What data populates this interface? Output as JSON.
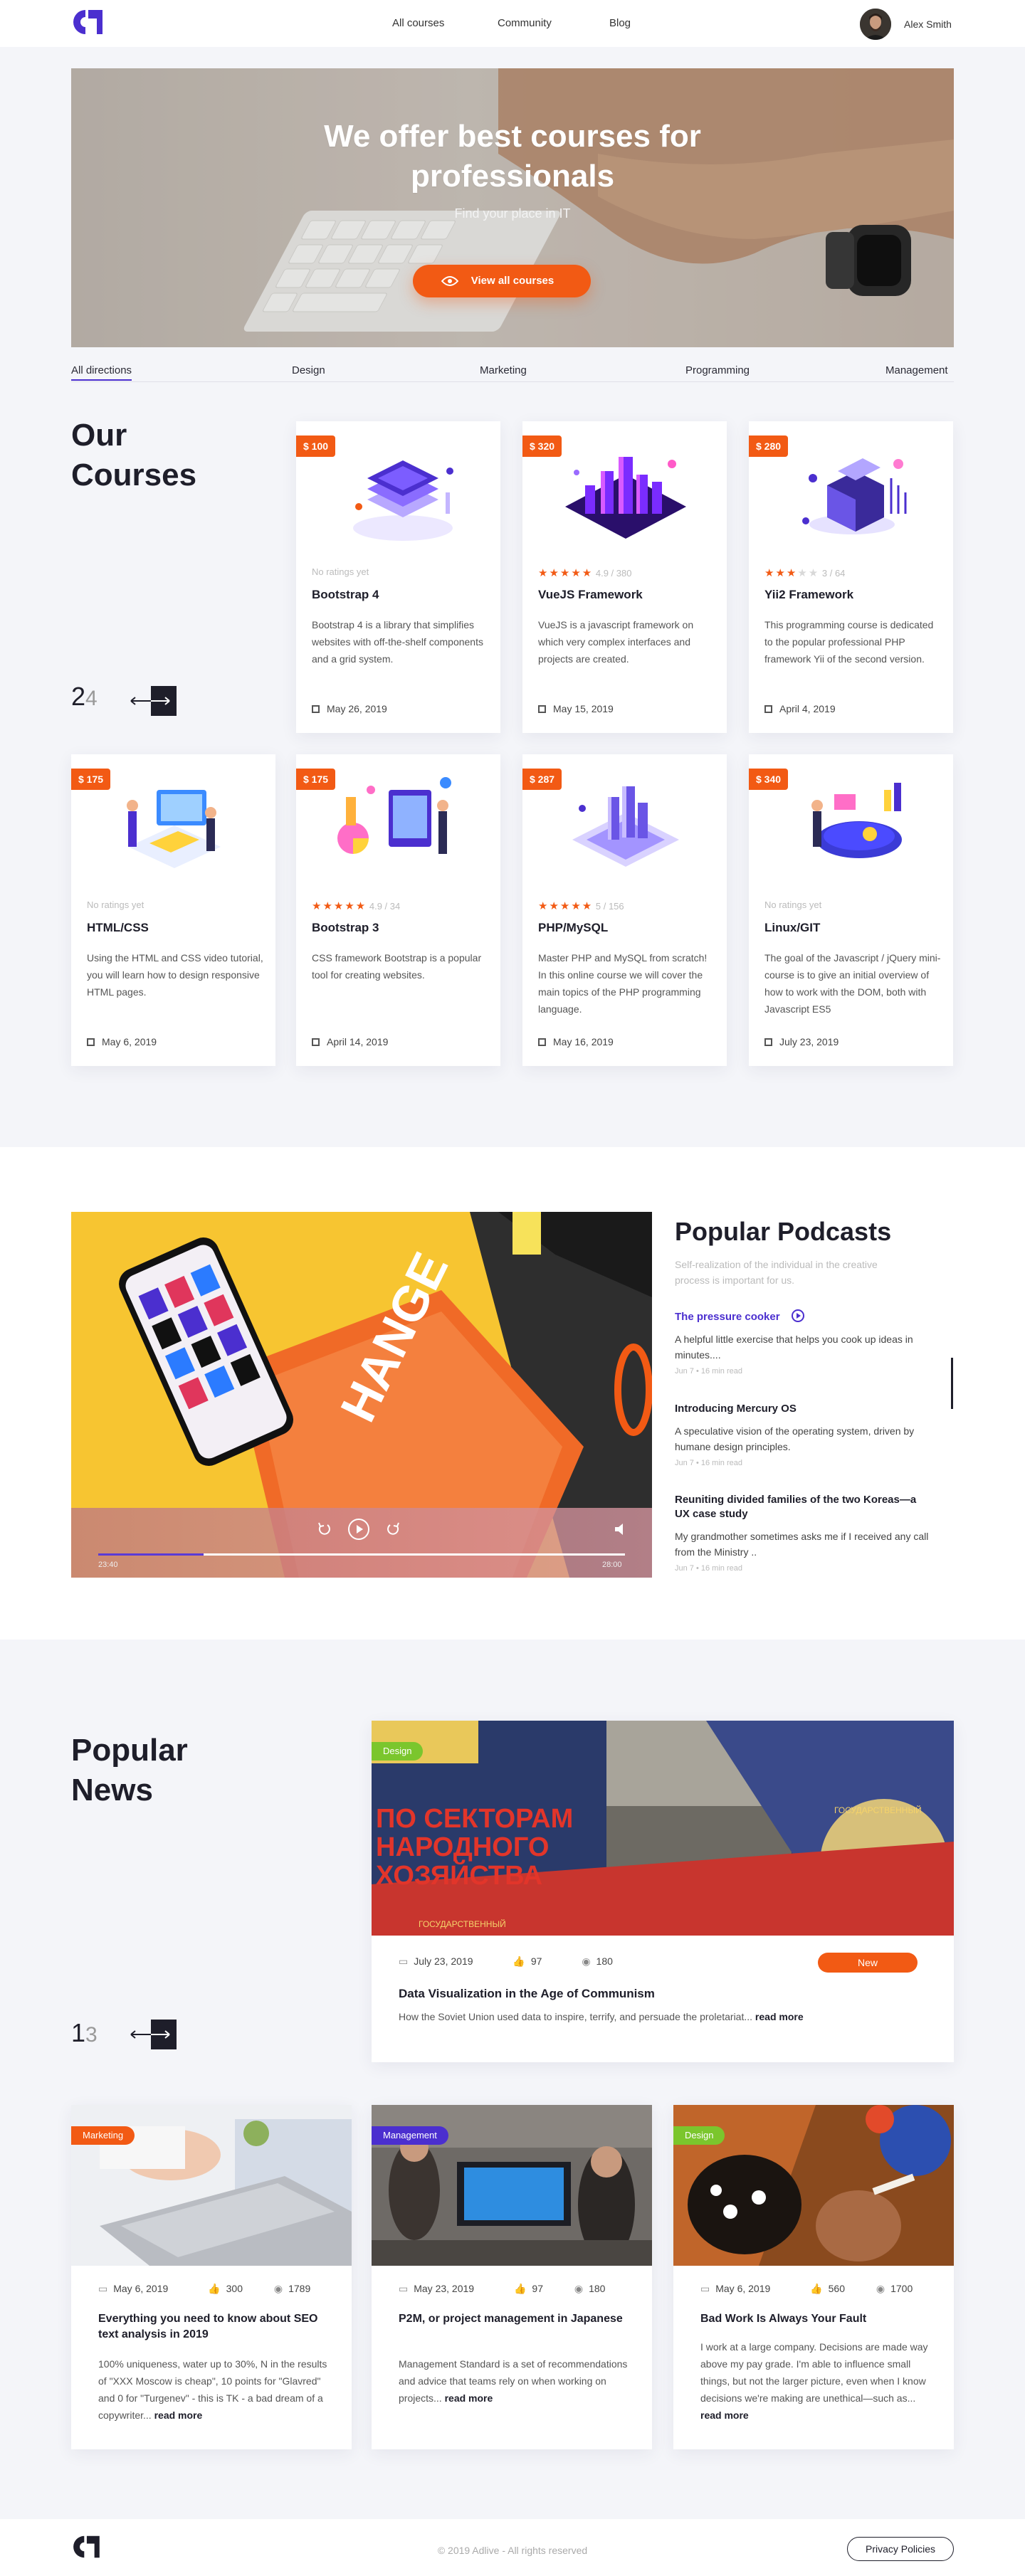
{
  "header": {
    "nav": [
      "All courses",
      "Community",
      "Blog"
    ],
    "user_name": "Alex Smith"
  },
  "hero": {
    "title_line1": "We offer best courses for",
    "title_line2": "professionals",
    "subtitle": "Find your place in IT",
    "button_label": "View all courses"
  },
  "tabs": [
    "All directions",
    "Design",
    "Marketing",
    "Programming",
    "Management"
  ],
  "courses": {
    "title_line1": "Our",
    "title_line2": "Courses",
    "page_current": "2",
    "page_total": "4",
    "items": [
      {
        "price": "$ 100",
        "rating_text": "No ratings yet",
        "title": "Bootstrap 4",
        "desc": "Bootstrap 4 is a library that simplifies websites with off-the-shelf components and a grid system.",
        "date": "May 26, 2019",
        "stars": 0,
        "score": ""
      },
      {
        "price": "$ 320",
        "rating_text": "4.9 / 380",
        "title": "VueJS Framework",
        "desc": "VueJS is a javascript framework on which very complex interfaces and projects are created.",
        "date": "May 15, 2019",
        "stars": 5,
        "score": "4.9 / 380"
      },
      {
        "price": "$ 280",
        "rating_text": "3 / 64",
        "title": "Yii2 Framework",
        "desc": "This programming course is dedicated to the popular professional PHP framework Yii of the second version.",
        "date": "April 4, 2019",
        "stars": 3,
        "score": "3 / 64"
      },
      {
        "price": "$ 175",
        "rating_text": "No ratings yet",
        "title": "HTML/CSS",
        "desc": "Using the HTML and CSS video tutorial, you will learn how to design responsive HTML pages.",
        "date": "May 6, 2019",
        "stars": 0,
        "score": ""
      },
      {
        "price": "$ 175",
        "rating_text": "4.9 / 34",
        "title": "Bootstrap 3",
        "desc": "CSS framework Bootstrap is a popular tool for creating websites.",
        "date": "April 14, 2019",
        "stars": 5,
        "score": "4.9 / 34"
      },
      {
        "price": "$ 287",
        "rating_text": "5 / 156",
        "title": "PHP/MySQL",
        "desc": "Master PHP and MySQL from scratch! In this online course we will cover the main topics of the PHP programming language.",
        "date": "May 16, 2019",
        "stars": 5,
        "score": "5 / 156"
      },
      {
        "price": "$ 340",
        "rating_text": "No ratings yet",
        "title": "Linux/GIT",
        "desc": "The goal of the Javascript / jQuery mini-course is to give an initial overview of how to work with the DOM, both with Javascript ES5",
        "date": "July 23, 2019",
        "stars": 0,
        "score": ""
      }
    ]
  },
  "podcasts": {
    "title": "Popular Podcasts",
    "subtitle": "Self-realization of the individual in the creative process is important for us.",
    "player": {
      "elapsed": "23:40",
      "total": "28:00",
      "progress": 0.2
    },
    "items": [
      {
        "title": "The pressure cooker",
        "desc": "A helpful little exercise that helps you cook up ideas in minutes....",
        "meta": "Jun 7  •  16 min read"
      },
      {
        "title": "Introducing Mercury OS",
        "desc": "A speculative vision of the operating system, driven by humane design principles.",
        "meta": "Jun 7  •  16 min read"
      },
      {
        "title": "Reuniting divided families of the two Koreas—a UX case study",
        "desc": "My grandmother sometimes asks me if I received any call from the Ministry ..",
        "meta": "Jun 7  •  16 min read"
      }
    ]
  },
  "news": {
    "title_line1": "Popular",
    "title_line2": "News",
    "page_current": "1",
    "page_total": "3",
    "featured": {
      "badge": "Design",
      "date": "July 23, 2019",
      "likes": "97",
      "views": "180",
      "new_label": "New",
      "title": "Data Visualization in the Age of Communism",
      "desc": "How the Soviet Union used data to inspire, terrify, and persuade the proletariat...",
      "read_more": "read more",
      "poster_text_1": "ПО СЕКТОРАМ",
      "poster_text_2": "НАРОДНОГО",
      "poster_text_3": "ХОЗЯЙСТВА",
      "poster_small": "ГОСУДАРСТВЕННЫЙ"
    },
    "items": [
      {
        "badge": "Marketing",
        "date": "May 6, 2019",
        "likes": "300",
        "views": "1789",
        "title": "Everything you need to know about SEO text analysis in 2019",
        "desc": "100% uniqueness, water up to 30%, N in the results of \"XXX Moscow is cheap\", 10 points for \"Glavred\" and 0 for \"Turgenev\" - this is TK - a bad dream of a copywriter...",
        "read_more": "read more"
      },
      {
        "badge": "Management",
        "date": "May 23, 2019",
        "likes": "97",
        "views": "180",
        "title": "P2M, or project management in Japanese",
        "desc": "Management Standard is a set of recommendations and advice that teams rely on when working on projects...",
        "read_more": "read more"
      },
      {
        "badge": "Design",
        "date": "May 6, 2019",
        "likes": "560",
        "views": "1700",
        "title": "Bad Work Is Always Your Fault",
        "desc": "I work at a large company. Decisions are made way above my pay grade. I'm able to influence small things, but not the larger picture, even when I know decisions we're making are unethical—such as...",
        "read_more": "read more"
      }
    ]
  },
  "footer": {
    "copyright": "© 2019 Adlive - All rights reserved",
    "policy": "Privacy Policies"
  },
  "colors": {
    "accent_orange": "#f25a14",
    "accent_purple": "#4b2fcf",
    "badge_green": "#7bc62d",
    "dark": "#1e1e2a"
  },
  "icons": [
    "logo-icon",
    "eye-icon",
    "calendar-icon",
    "like-icon",
    "views-icon",
    "play-icon",
    "rewind-icon",
    "forward-icon",
    "volume-icon",
    "arrow-left-icon",
    "arrow-right-icon"
  ]
}
